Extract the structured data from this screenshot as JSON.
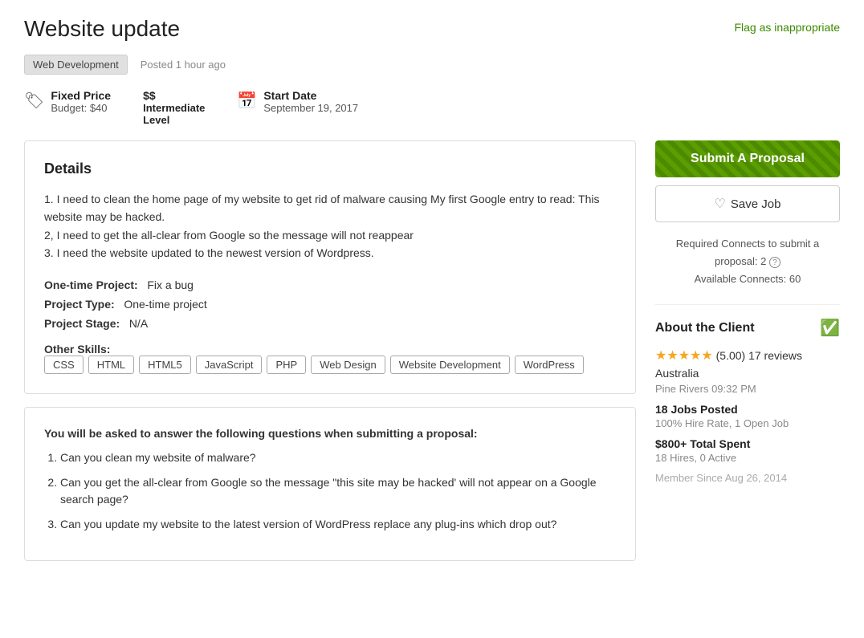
{
  "header": {
    "title": "Website update",
    "flag_label": "Flag as inappropriate"
  },
  "meta": {
    "category": "Web Development",
    "posted": "Posted 1 hour ago"
  },
  "job_info": {
    "price_type_label": "Fixed Price",
    "budget_label": "Budget: $40",
    "level_symbol": "$$",
    "level_label": "Intermediate",
    "level_sub": "Level",
    "start_date_label": "Start Date",
    "start_date_value": "September 19, 2017"
  },
  "details": {
    "title": "Details",
    "description": "1. I need to clean the home page of my website to get rid of malware causing My first Google entry to read: This website may be hacked.\n2. I need to get the all-clear from Google so the message will not reappear\n3. I need the website updated to the newest version of Wordpress.",
    "project_type_label": "One-time Project:",
    "project_type_value": "Fix a bug",
    "project_type_row_label": "Project Type:",
    "project_type_row_value": "One-time project",
    "project_stage_label": "Project Stage:",
    "project_stage_value": "N/A",
    "other_skills_label": "Other Skills:",
    "skills": [
      "CSS",
      "HTML",
      "HTML5",
      "JavaScript",
      "PHP",
      "Web Design",
      "Website Development",
      "WordPress"
    ]
  },
  "questions": {
    "intro": "You will be asked to answer the following questions when submitting a proposal:",
    "items": [
      "Can you clean my website of malware?",
      "Can you get the all-clear from Google so the message \"this site may be hacked' will not appear on a Google search page?",
      "Can you update my website to the latest version of WordPress replace any plug-ins which drop out?"
    ]
  },
  "sidebar": {
    "submit_label": "Submit A Proposal",
    "save_label": "Save Job",
    "connects_text": "Required Connects to submit a proposal: 2",
    "available_connects": "Available Connects: 60",
    "about_title": "About the Client",
    "rating": "5.00",
    "review_count": "17 reviews",
    "country": "Australia",
    "location": "Pine Rivers 09:32 PM",
    "jobs_posted_label": "18 Jobs Posted",
    "hire_rate": "100% Hire Rate, 1 Open Job",
    "total_spent_label": "$800+ Total Spent",
    "hires": "18 Hires, 0 Active",
    "member_since": "Member Since Aug 26, 2014"
  }
}
